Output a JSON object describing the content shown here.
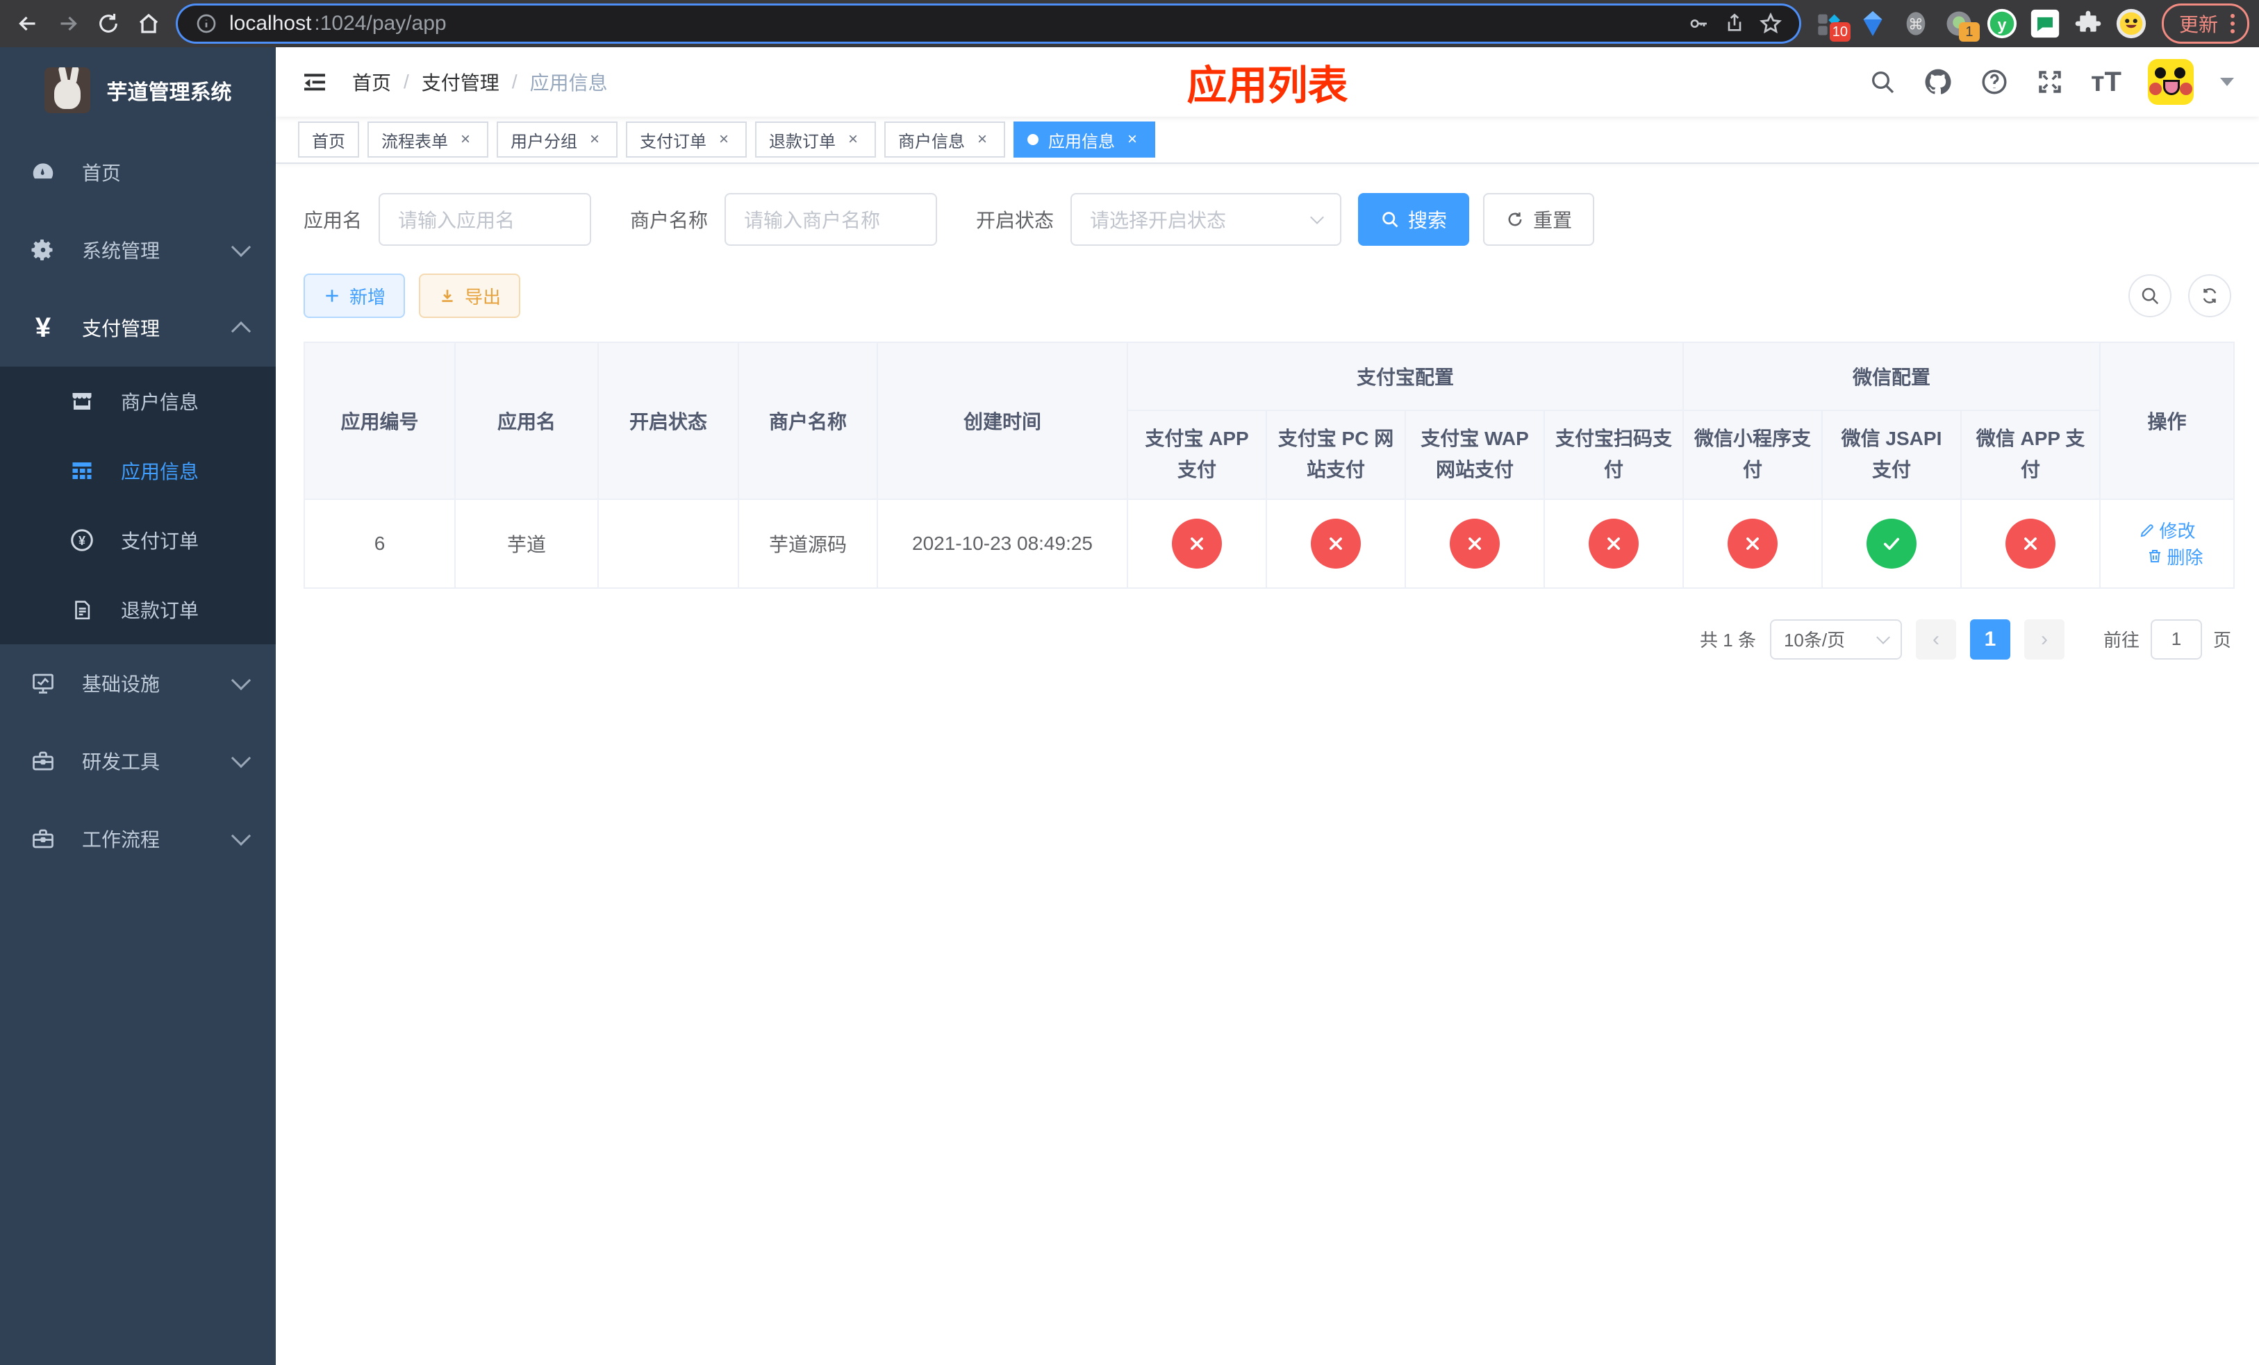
{
  "browser": {
    "url_host": "localhost",
    "url_path": ":1024/pay/app",
    "update_label": "更新",
    "ext_badge_1": "10",
    "ext_badge_2": "1"
  },
  "sidebar": {
    "title": "芋道管理系统",
    "menu": [
      {
        "label": "首页"
      },
      {
        "label": "系统管理"
      },
      {
        "label": "支付管理"
      },
      {
        "label": "商户信息"
      },
      {
        "label": "应用信息"
      },
      {
        "label": "支付订单"
      },
      {
        "label": "退款订单"
      },
      {
        "label": "基础设施"
      },
      {
        "label": "研发工具"
      },
      {
        "label": "工作流程"
      }
    ]
  },
  "header": {
    "breadcrumb": [
      "首页",
      "支付管理",
      "应用信息"
    ],
    "page_title": "应用列表"
  },
  "tabs": [
    {
      "label": "首页",
      "closable": false,
      "active": false
    },
    {
      "label": "流程表单",
      "closable": true,
      "active": false
    },
    {
      "label": "用户分组",
      "closable": true,
      "active": false
    },
    {
      "label": "支付订单",
      "closable": true,
      "active": false
    },
    {
      "label": "退款订单",
      "closable": true,
      "active": false
    },
    {
      "label": "商户信息",
      "closable": true,
      "active": false
    },
    {
      "label": "应用信息",
      "closable": true,
      "active": true
    }
  ],
  "filters": {
    "app_name_label": "应用名",
    "app_name_placeholder": "请输入应用名",
    "merchant_label": "商户名称",
    "merchant_placeholder": "请输入商户名称",
    "status_label": "开启状态",
    "status_placeholder": "请选择开启状态",
    "search_label": "搜索",
    "reset_label": "重置"
  },
  "toolbar": {
    "add_label": "新增",
    "export_label": "导出"
  },
  "table": {
    "headers": {
      "id": "应用编号",
      "name": "应用名",
      "enabled": "开启状态",
      "merchant": "商户名称",
      "created": "创建时间",
      "alipay_group": "支付宝配置",
      "wechat_group": "微信配置",
      "operation": "操作"
    },
    "sub_headers": [
      "支付宝 APP 支付",
      "支付宝 PC 网站支付",
      "支付宝 WAP 网站支付",
      "支付宝扫码支付",
      "微信小程序支付",
      "微信 JSAPI 支付",
      "微信 APP 支付"
    ],
    "row": {
      "id": "6",
      "name": "芋道",
      "enabled": true,
      "merchant": "芋道源码",
      "created": "2021-10-23 08:49:25",
      "statuses": [
        false,
        false,
        false,
        false,
        false,
        true,
        false
      ],
      "edit_label": "修改",
      "delete_label": "删除"
    }
  },
  "pagination": {
    "total": "共 1 条",
    "page_size": "10条/页",
    "prev": "‹",
    "page": "1",
    "next": "›",
    "goto_label": "前往",
    "goto_value": "1",
    "page_unit": "页"
  },
  "colors": {
    "accent": "#409eff",
    "danger": "#f45454",
    "success": "#21c160",
    "title_red": "#ff3000",
    "sidebar_bg": "#304156",
    "submenu_bg": "#1f2d3d"
  }
}
